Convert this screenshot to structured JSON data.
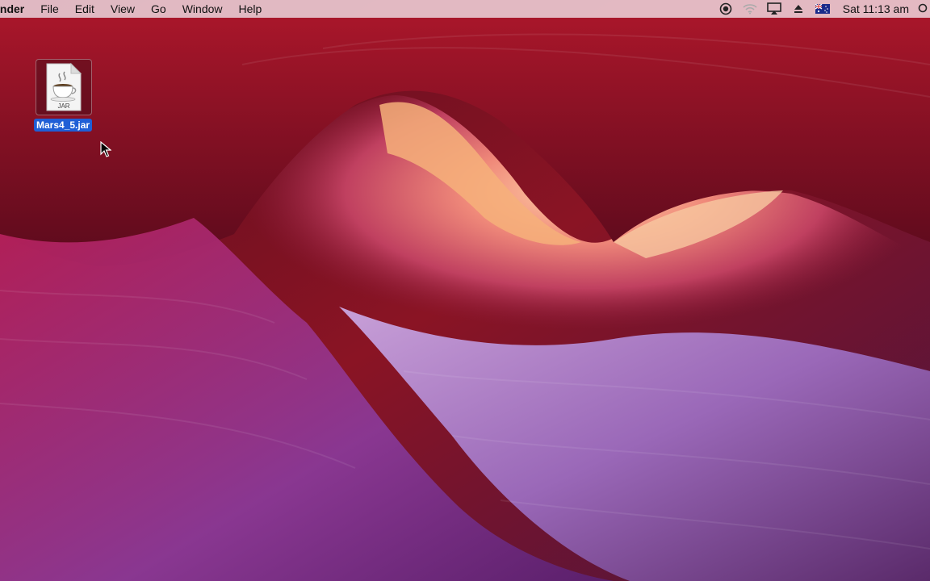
{
  "menubar": {
    "app_name": "inder",
    "items": [
      "File",
      "Edit",
      "View",
      "Go",
      "Window",
      "Help"
    ],
    "status_icons": [
      "screen-record-icon",
      "wifi-icon",
      "airplay-icon",
      "eject-icon",
      "australia-flag-icon"
    ],
    "clock": "Sat 11:13 am",
    "search_icon": "spotlight-search-icon"
  },
  "desktop": {
    "icons": [
      {
        "name": "Mars4_5.jar",
        "file_badge": "JAR",
        "icon": "java-jar-file-icon",
        "selected": true
      }
    ]
  },
  "colors": {
    "menubar_bg": "#ecc8d0",
    "selection": "#1f5fd6",
    "wallpaper_primary": "#8a1424",
    "wallpaper_secondary": "#7a4a9a"
  }
}
